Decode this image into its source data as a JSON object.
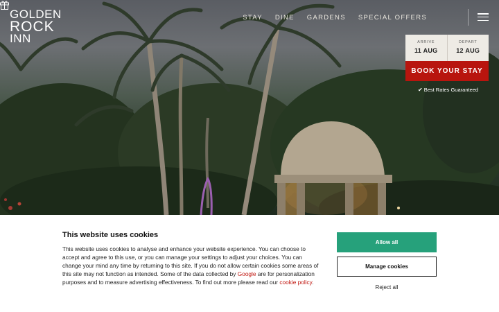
{
  "brand": {
    "line1": "GOLDEN",
    "line2": "ROCK",
    "line3": "INN"
  },
  "nav": {
    "items": [
      "STAY",
      "DINE",
      "GARDENS",
      "SPECIAL OFFERS"
    ]
  },
  "header_icons": [
    "gift-icon",
    "menu-icon"
  ],
  "booking": {
    "arrive_label": "ARRIVE",
    "arrive_value": "11 AUG",
    "depart_label": "DEPART",
    "depart_value": "12 AUG",
    "book_label": "BOOK YOUR STAY",
    "best_rates": "Best Rates Guaranteed"
  },
  "cookie": {
    "title": "This website uses cookies",
    "body_before_google": "This website uses cookies to analyse and enhance your website experience. You can choose to accept and agree to this use, or you can manage your settings to adjust your choices. You can change your mind any time by returning to this site. If you do not allow certain cookies some areas of this site may not function as intended. Some of the data collected by ",
    "google_link": "Google",
    "body_middle": " are for personalization purposes and to measure advertising effectiveness. To find out more please read our ",
    "policy_link": "cookie policy",
    "body_end": ".",
    "allow_label": "Allow all",
    "manage_label": "Manage cookies",
    "reject_label": "Reject all"
  },
  "colors": {
    "book_button": "#b8150e",
    "allow_button": "#26a17b",
    "link": "#c0160f"
  }
}
